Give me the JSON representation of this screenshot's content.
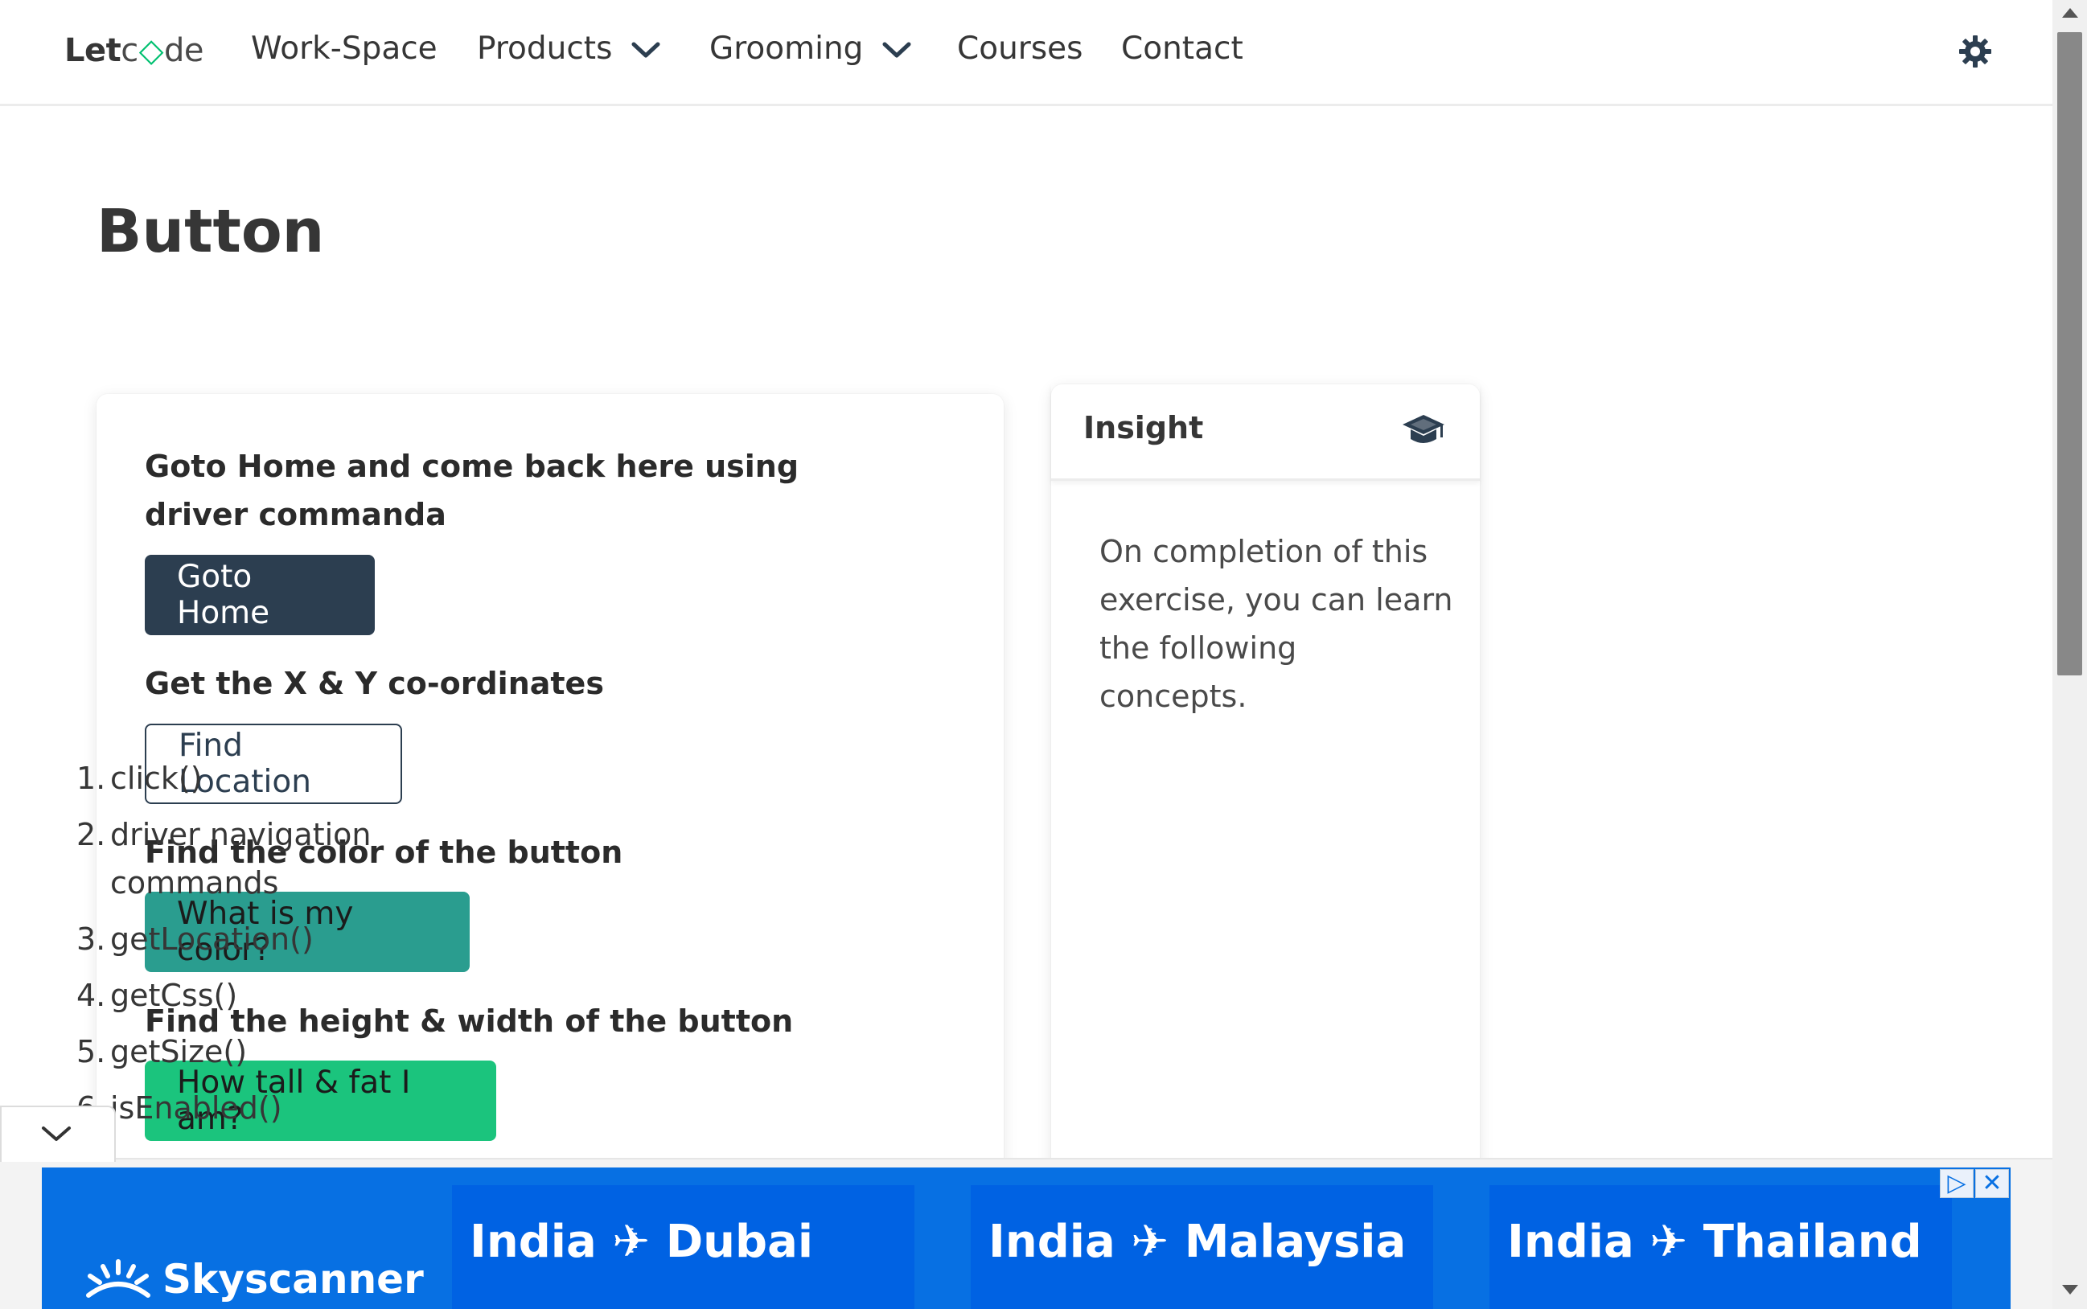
{
  "nav": {
    "logo_let": "Let",
    "logo_c": "c",
    "logo_diamond": "◇",
    "logo_de": "de",
    "items": [
      {
        "label": "Work-Space"
      },
      {
        "label": "Products"
      },
      {
        "label": "Grooming"
      },
      {
        "label": "Courses"
      },
      {
        "label": "Contact"
      }
    ],
    "theme_icon": "gear-icon"
  },
  "page": {
    "title": "Button"
  },
  "exercises": [
    {
      "label": "Goto Home and come back here using driver commanda",
      "button": "Goto Home"
    },
    {
      "label": "Get the X & Y co-ordinates",
      "button": "Find Location"
    },
    {
      "label": "Find the color of the button",
      "button": "What is my color?"
    },
    {
      "label": "Find the height & width of the button",
      "button": "How tall & fat I am?"
    }
  ],
  "insight": {
    "title": "Insight",
    "icon": "graduation-cap-icon",
    "intro": "On completion of this exercise, you can learn the following concepts.",
    "items": [
      {
        "num": "1.",
        "text": "click()"
      },
      {
        "num": "2.",
        "text": "driver navigation commands"
      },
      {
        "num": "3.",
        "text": "getLocation()"
      },
      {
        "num": "4.",
        "text": "getCss()"
      },
      {
        "num": "5.",
        "text": "getSize()"
      },
      {
        "num": "6.",
        "text": "isEnabled()"
      }
    ]
  },
  "ad": {
    "brand": "Skyscanner",
    "tiles": [
      {
        "text": "India ✈ Dubai"
      },
      {
        "text": "India ✈ Malaysia"
      },
      {
        "text": "India ✈ Thailand"
      }
    ],
    "adchoices": "▷",
    "close": "✕"
  },
  "colors": {
    "primary_dark": "#2c3e50",
    "teal": "#2a9d8f",
    "green": "#1bc47d",
    "ad_blue": "#0770e3"
  }
}
